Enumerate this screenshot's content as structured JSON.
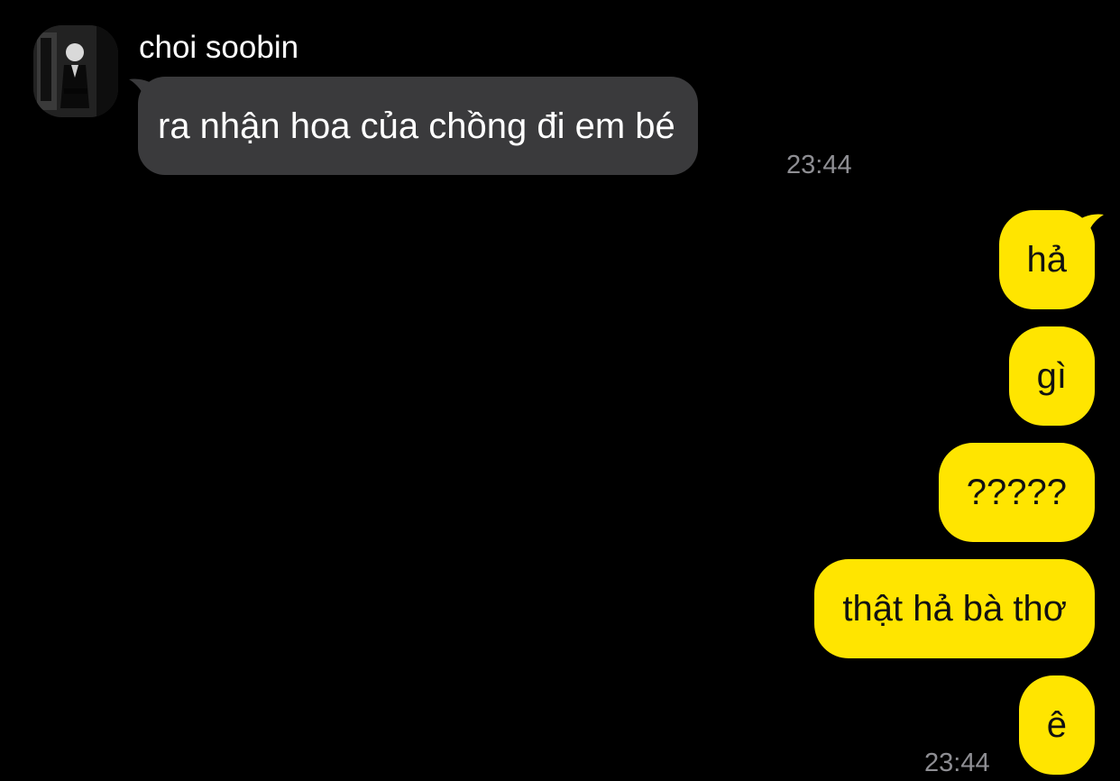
{
  "conversation": {
    "contact_name": "choi soobin",
    "avatar_icon": "profile-photo-icon",
    "incoming": [
      {
        "text": "ra nhận hoa của chồng đi em bé",
        "time": "23:44"
      }
    ],
    "outgoing": [
      {
        "text": "hả"
      },
      {
        "text": "gì"
      },
      {
        "text": "?????"
      },
      {
        "text": "thật hả bà thơ"
      },
      {
        "text": "ê",
        "time": "23:44"
      }
    ]
  },
  "colors": {
    "background": "#000000",
    "incoming_bubble": "#3a3a3c",
    "outgoing_bubble": "#ffe500",
    "timestamp": "#8e8e93"
  }
}
